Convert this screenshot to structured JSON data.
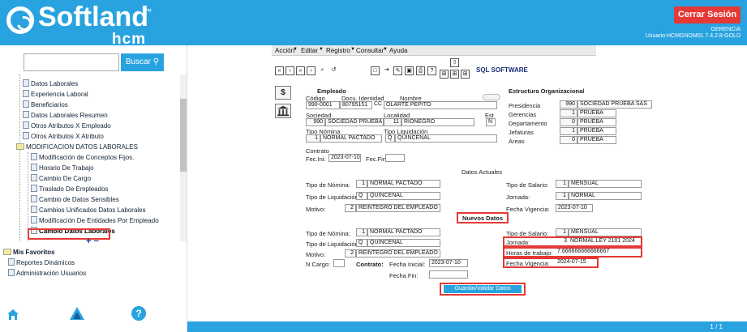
{
  "header": {
    "brand": "Softland",
    "tm": "™",
    "sub": "hcm",
    "logout": "Cerrar Sesión",
    "role": "GERENCIA",
    "user": "Usuario:HCMGNOM01 7.4.2.8-GOLD"
  },
  "search": {
    "button": "Buscar",
    "icon": "search-icon"
  },
  "tree": {
    "items": [
      "Datos Laborales",
      "Experiencia Laboral",
      "Beneficiarios",
      "Datos Laborales Resumen",
      "Otros Atributos X Empleado",
      "Otros Atributos X Atributo",
      "MODIFICACION DATOS LABORALES",
      "Modificación de Conceptos Fijos.",
      "Horario De Trabajo",
      "Cambio De Cargo",
      "Traslado De Empleados",
      "Cambio de Datos Sensibles",
      "Cambios Unificados Datos Laborales",
      "Modificación De Entidades Por Empleado",
      "Cambio Datos Laborales"
    ],
    "plusminus": "+ −"
  },
  "favorites": {
    "title": "Mis Favoritos",
    "items": [
      "Reportes Dinámicos",
      "Administración Usuarios"
    ]
  },
  "menu": {
    "items": [
      "Acción",
      "Editar",
      "Registro",
      "Consultar",
      "Ayuda"
    ]
  },
  "toolbar": {
    "vendor": "SQL SOFTWARE"
  },
  "empleado": {
    "title": "Empleado",
    "codigo_lbl": "Código",
    "docu_lbl": "Docu. Identidad",
    "nombre_lbl": "Nombre",
    "codigo": "990-0001",
    "docu": "80795151",
    "cc": "CC",
    "nombre": "OLARTE PEPITO",
    "sociedad_lbl": "Sociedad",
    "localidad_lbl": "Localidad",
    "est_lbl": "Est",
    "soc_n": "990",
    "soc": "SOCIEDAD PRUEBA SAS",
    "loc_n": "11",
    "loc": "RIONEGRO",
    "est": "N",
    "tn_lbl": "Tipo Nómina",
    "tl_lbl": "Tipo Liquidación",
    "tn_n": "1",
    "tn": "NORMAL PACTADO",
    "tl_n": "Q",
    "tl": "QUINCENAL",
    "contrato_lbl": "Contrato",
    "fini_lbl": "Fec.Ini:",
    "fini": "2023-07-10",
    "ffin_lbl": "Fec.Fin:"
  },
  "estructura": {
    "title": "Estructura Organizacional",
    "rows": [
      {
        "label": "Presidencia",
        "n": "990",
        "v": "SOCIEDAD PRUEBA SAS"
      },
      {
        "label": "Gerencias",
        "n": "1",
        "v": "PRUEBA"
      },
      {
        "label": "Departamento",
        "n": "0",
        "v": "PRUEBA"
      },
      {
        "label": "Jefaturas",
        "n": "1",
        "v": "PRUEBA"
      },
      {
        "label": "Areas",
        "n": "0",
        "v": "PRUEBA"
      }
    ]
  },
  "actuales": {
    "title": "Datos Actuales",
    "tn_lbl": "Tipo de Nómina:",
    "tn_n": "1",
    "tn": "NORMAL PACTADO",
    "tl_lbl": "Tipo de Liquidación:",
    "tl_n": "Q",
    "tl": "QUINCENAL",
    "mot_lbl": "Motivo:",
    "mot_n": "2",
    "mot": "REINTEGRO DEL EMPLEADO",
    "ts_lbl": "Tipo de Salario:",
    "ts_n": "1",
    "ts": "MENSUAL",
    "jor_lbl": "Jornada:",
    "jor_n": "1",
    "jor": "NORMAL",
    "fv_lbl": "Fecha Vigencia:",
    "fv": "2023-07-10"
  },
  "nuevos": {
    "title": "Nuevos Datos",
    "tn_lbl": "Tipo de Nómina:",
    "tn_n": "1",
    "tn": "NORMAL PACTADO",
    "tl_lbl": "Tipo de Liquidación:",
    "tl_n": "Q",
    "tl": "QUINCENAL",
    "mot_lbl": "Motivo:",
    "mot_n": "2",
    "mot": "REINTEGRO DEL EMPLEADO",
    "ncargo_lbl": "N Cargo:",
    "contrato_lbl": "Contrato:",
    "fi_lbl": "Fecha Inicial:",
    "fi": "2023-07-10",
    "ff_lbl": "Fecha Fin:",
    "ts_lbl": "Tipo de Salario:",
    "ts_n": "1",
    "ts": "MENSUAL",
    "jor_lbl": "Jornada:",
    "jor_n": "3",
    "jor": "NORMAL LEY 2101 2024",
    "ht_lbl": "Horas de trabajo:",
    "ht": "7.666666666666667",
    "fv_lbl": "Fecha Vigencia:",
    "fv": "2024-07-15",
    "save": "Guardar/Validar Datos"
  },
  "footer": {
    "page": "1 / 1"
  }
}
